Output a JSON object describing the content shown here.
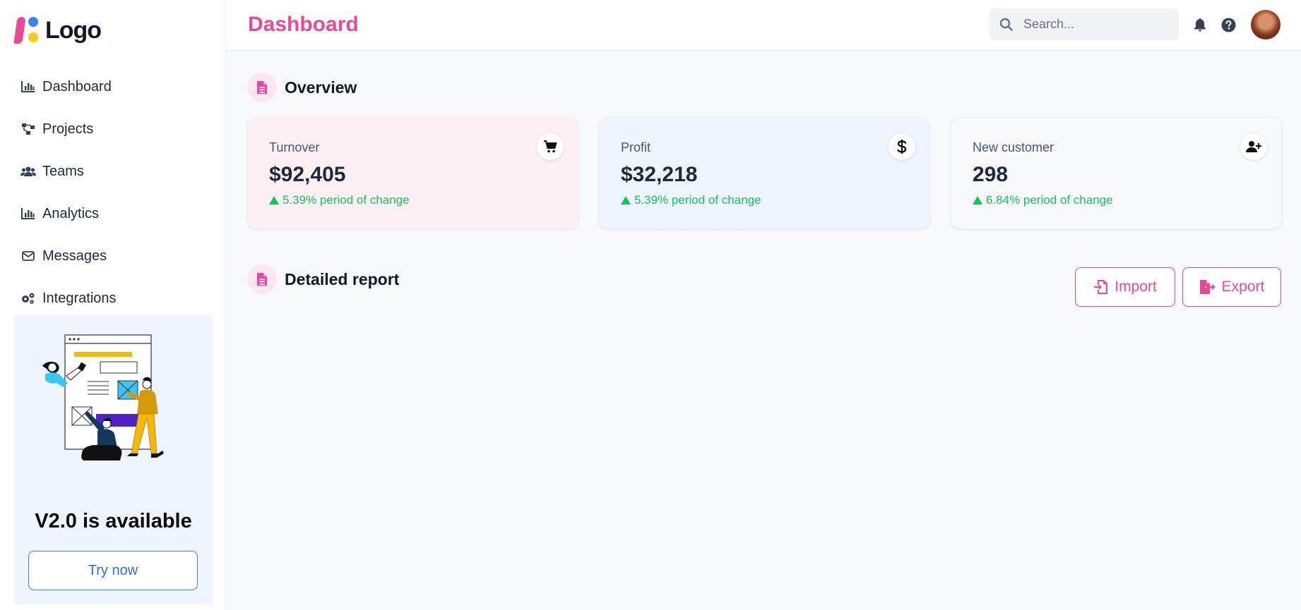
{
  "app": {
    "logo_text": "Logo",
    "brand_colors": {
      "accent": "#ec4899",
      "blue": "#3b82f6",
      "yellow": "#facc15",
      "green": "#16c25a"
    }
  },
  "sidebar": {
    "items": [
      {
        "label": "Dashboard",
        "icon": "bar-chart-icon"
      },
      {
        "label": "Projects",
        "icon": "sitemap-icon"
      },
      {
        "label": "Teams",
        "icon": "users-icon"
      },
      {
        "label": "Analytics",
        "icon": "bar-chart-icon"
      },
      {
        "label": "Messages",
        "icon": "envelope-icon"
      },
      {
        "label": "Integrations",
        "icon": "gears-icon"
      }
    ],
    "promo": {
      "title": "V2.0 is available",
      "button_label": "Try now",
      "illustration": "team-collaboration-illustration"
    }
  },
  "header": {
    "title": "Dashboard",
    "search_placeholder": "Search...",
    "icons": [
      "bell-icon",
      "help-icon",
      "avatar"
    ]
  },
  "overview": {
    "title": "Overview",
    "cards": [
      {
        "label": "Turnover",
        "value": "$92,405",
        "change": "5.39% period of change",
        "icon": "cart-icon",
        "bg": "#fdf0f5"
      },
      {
        "label": "Profit",
        "value": "$32,218",
        "change": "5.39% period of change",
        "icon": "dollar-icon",
        "bg": "#eef5ff"
      },
      {
        "label": "New customer",
        "value": "298",
        "change": "6.84% period of change",
        "icon": "user-plus-icon",
        "bg": "#f8f9fb"
      }
    ]
  },
  "report": {
    "title": "Detailed report",
    "import_label": "Import",
    "export_label": "Export"
  }
}
